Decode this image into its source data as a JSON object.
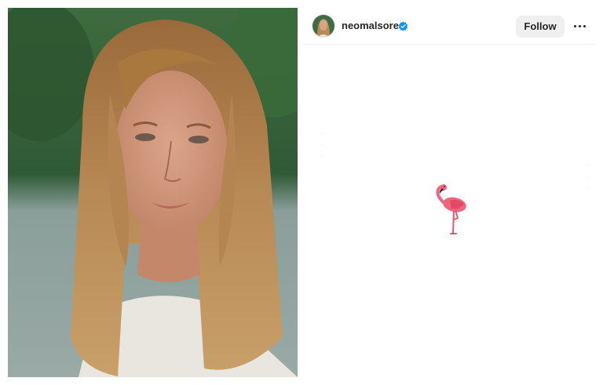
{
  "profile": {
    "username": "neomalsore",
    "verified": true
  },
  "header": {
    "follow_label": "Follow"
  },
  "post": {
    "content_emoji": "flamingo-emoji"
  },
  "colors": {
    "verified_blue": "#0095f6",
    "follow_button_bg": "#efefef",
    "text": "#262626",
    "flamingo_pink": "#f0657d"
  },
  "icons": {
    "verified": "verified-badge-icon",
    "more": "more-options-icon"
  }
}
